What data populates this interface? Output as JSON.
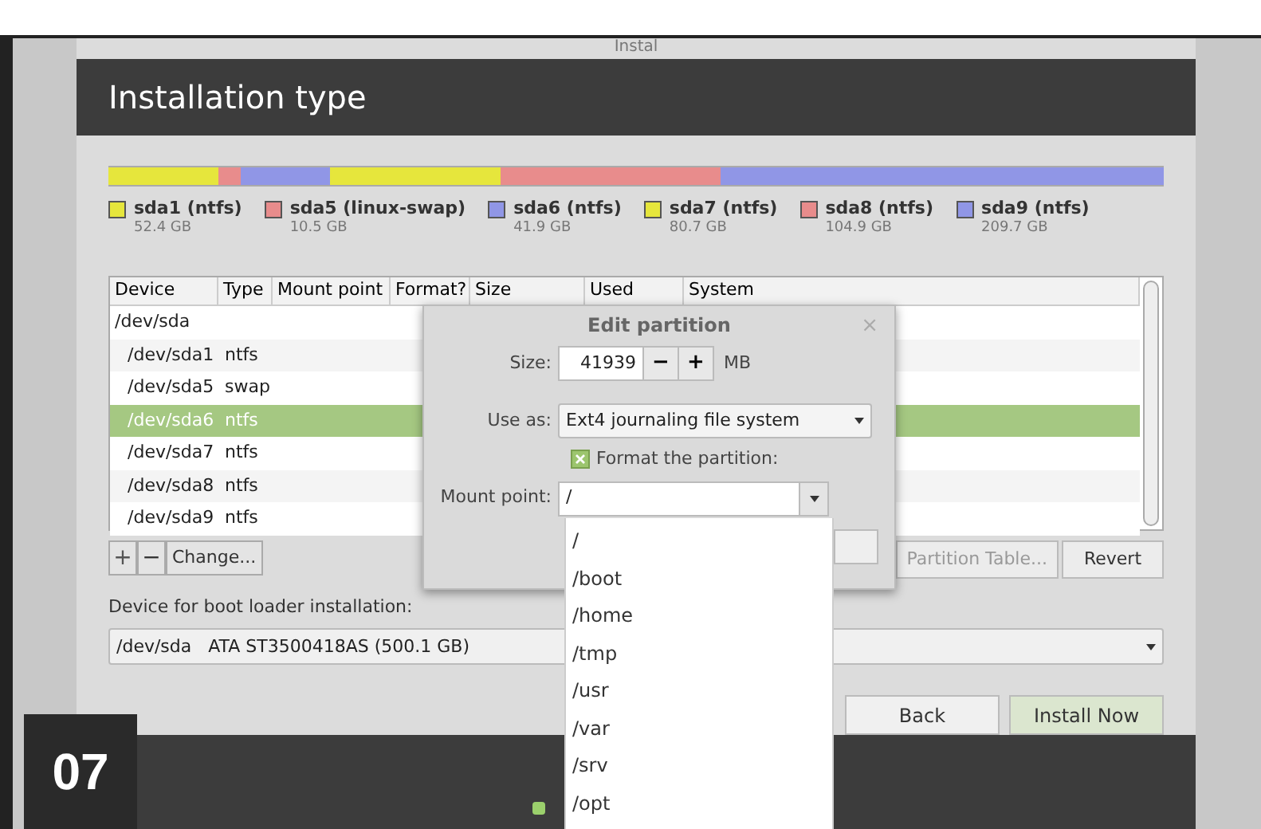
{
  "window": {
    "title": "Instal",
    "heading": "Installation type"
  },
  "partitions": [
    {
      "name": "sda1 (ntfs)",
      "size": "52.4 GB",
      "color": "#e6e63c"
    },
    {
      "name": "sda5 (linux-swap)",
      "size": "10.5 GB",
      "color": "#e88c8c"
    },
    {
      "name": "sda6 (ntfs)",
      "size": "41.9 GB",
      "color": "#9096e6"
    },
    {
      "name": "sda7 (ntfs)",
      "size": "80.7 GB",
      "color": "#e6e63c"
    },
    {
      "name": "sda8 (ntfs)",
      "size": "104.9 GB",
      "color": "#e88c8c"
    },
    {
      "name": "sda9 (ntfs)",
      "size": "209.7 GB",
      "color": "#9096e6"
    }
  ],
  "table": {
    "columns": [
      "Device",
      "Type",
      "Mount point",
      "Format?",
      "Size",
      "Used",
      "System"
    ],
    "rows": [
      {
        "device": "/dev/sda",
        "type": "",
        "selected": false,
        "child": false
      },
      {
        "device": "/dev/sda1",
        "type": "ntfs",
        "selected": false,
        "child": true
      },
      {
        "device": "/dev/sda5",
        "type": "swap",
        "selected": false,
        "child": true
      },
      {
        "device": "/dev/sda6",
        "type": "ntfs",
        "selected": true,
        "child": true
      },
      {
        "device": "/dev/sda7",
        "type": "ntfs",
        "selected": false,
        "child": true
      },
      {
        "device": "/dev/sda8",
        "type": "ntfs",
        "selected": false,
        "child": true
      },
      {
        "device": "/dev/sda9",
        "type": "ntfs",
        "selected": false,
        "child": true
      }
    ]
  },
  "table_buttons": {
    "add": "+",
    "remove": "−",
    "change": "Change...",
    "new_table": "Partition Table...",
    "revert": "Revert"
  },
  "boot_loader": {
    "label": "Device for boot loader installation:",
    "value": "/dev/sda   ATA ST3500418AS (500.1 GB)"
  },
  "nav_buttons": [
    {
      "label": "Back",
      "kind": "plain"
    },
    {
      "label": "Install Now",
      "kind": "primary"
    }
  ],
  "dialog": {
    "title": "Edit partition",
    "close": "×",
    "size_label": "Size:",
    "size_value": "41939",
    "minus": "−",
    "plus": "+",
    "unit": "MB",
    "use_as_label": "Use as:",
    "use_as_value": "Ext4 journaling file system",
    "format": {
      "label": "Format the partition:",
      "checked": true
    },
    "mount_label": "Mount point:",
    "mount_value": "/"
  },
  "mount_options": [
    "/",
    "/boot",
    "/home",
    "/tmp",
    "/usr",
    "/var",
    "/srv",
    "/opt"
  ],
  "step_badge": "07"
}
